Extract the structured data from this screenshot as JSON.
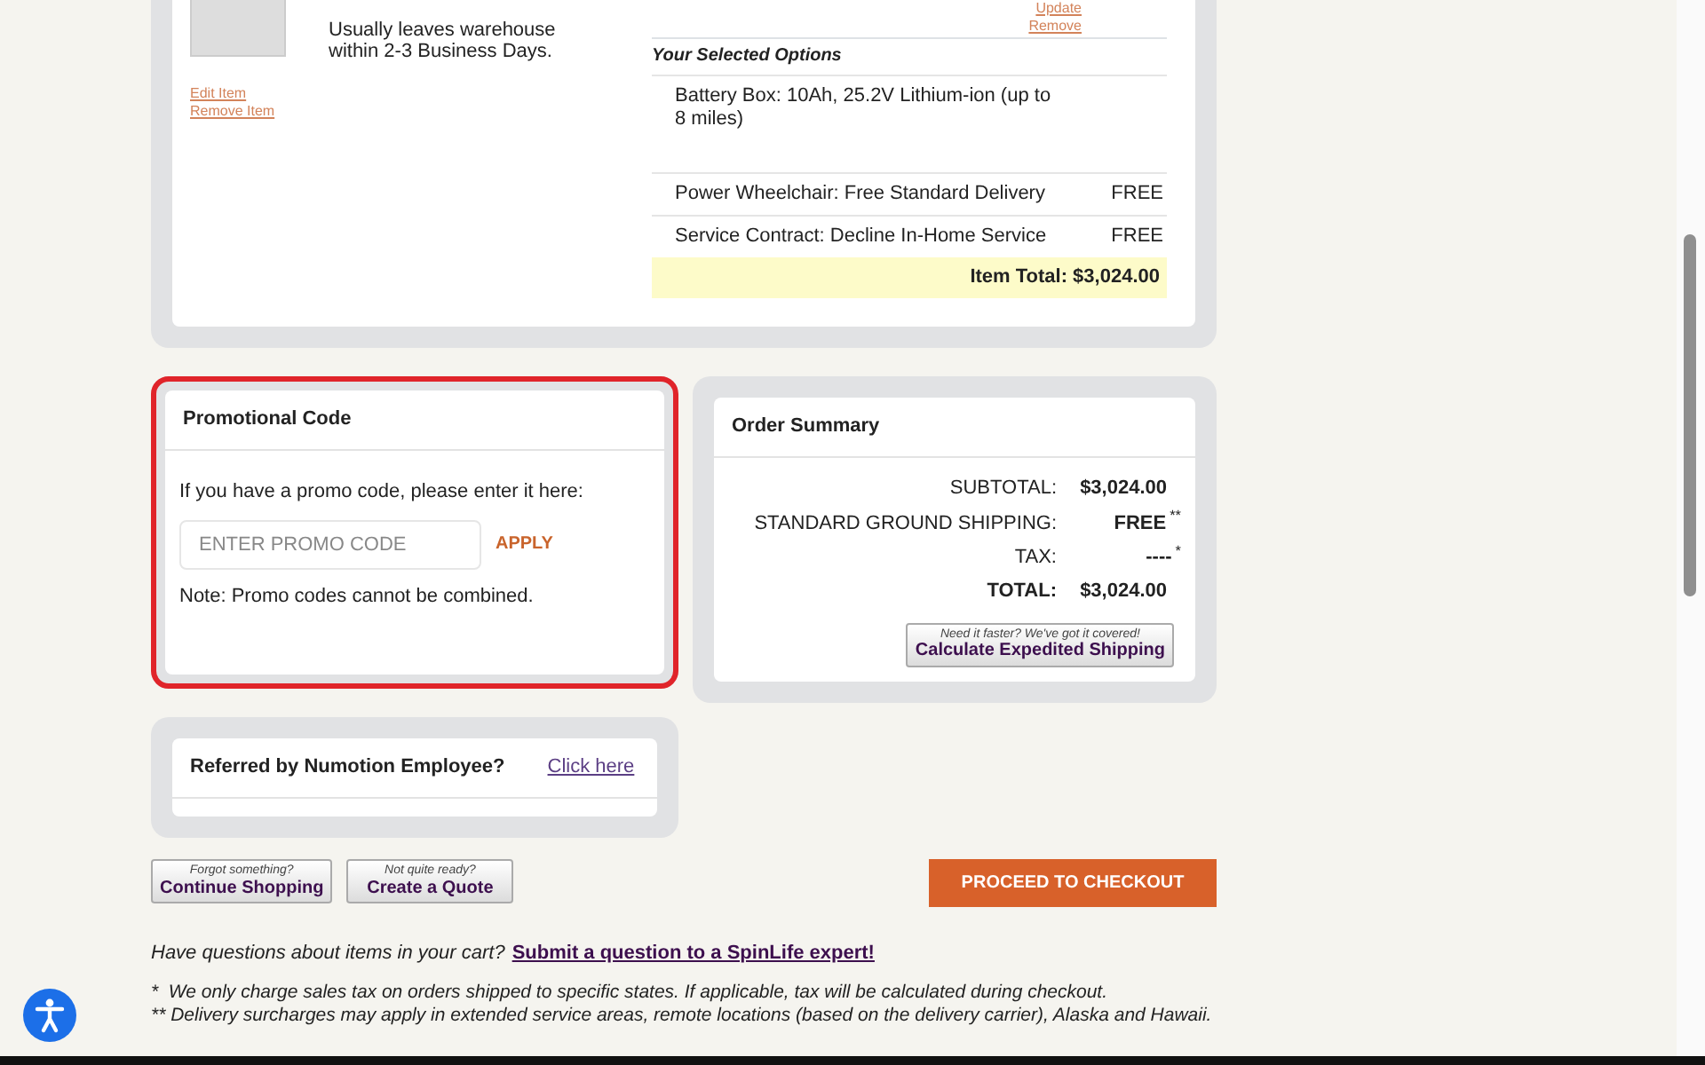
{
  "cart_item": {
    "availability": "Usually leaves warehouse within 2-3 Business Days.",
    "edit_link": "Edit Item",
    "remove_link": "Remove Item",
    "update_link": "Update",
    "remove_option_link": "Remove",
    "options_heading": "Your Selected Options",
    "options": [
      {
        "label": "Battery Box: 10Ah, 25.2V Lithium-ion (up to 8 miles)"
      },
      {
        "label": "Power Wheelchair: Free Standard Delivery",
        "price": "FREE"
      },
      {
        "label": "Service Contract: Decline In-Home Service",
        "price": "FREE"
      }
    ],
    "item_total": "Item Total: $3,024.00"
  },
  "promo": {
    "title": "Promotional Code",
    "highlighted": true,
    "prompt": "If you have a promo code, please enter it here:",
    "placeholder": "ENTER PROMO CODE",
    "apply": "APPLY",
    "note": "Note: Promo codes cannot be combined."
  },
  "referral": {
    "title": "Referred by Numotion Employee?",
    "link": "Click here"
  },
  "order_summary": {
    "title": "Order Summary",
    "rows": [
      {
        "kind": "normal",
        "label": "SUBTOTAL:",
        "value": "$3,024.00"
      },
      {
        "kind": "normal",
        "label": "STANDARD GROUND SHIPPING:",
        "value": "FREE",
        "note_mark": "**"
      },
      {
        "kind": "normal",
        "label": "TAX:",
        "value": "----",
        "note_mark": "*"
      },
      {
        "kind": "total",
        "label": "TOTAL:",
        "value": "$3,024.00"
      }
    ],
    "expedited_button": {
      "tagline": "Need it faster? We've got it covered!",
      "label": "Calculate Expedited Shipping"
    }
  },
  "actions": {
    "continue": {
      "tagline": "Forgot something?",
      "label": "Continue Shopping"
    },
    "quote": {
      "tagline": "Not quite ready?",
      "label": "Create a Quote"
    },
    "checkout": "PROCEED TO CHECKOUT"
  },
  "question": {
    "text": "Have questions about items in your cart?",
    "link": "Submit a question to a SpinLife expert!"
  },
  "footnotes": [
    "*  We only charge sales tax on orders shipped to specific states. If applicable, tax will be calculated during checkout.",
    "** Delivery surcharges may apply in extended service areas, remote locations (based on the delivery carrier), Alaska and Hawaii."
  ]
}
